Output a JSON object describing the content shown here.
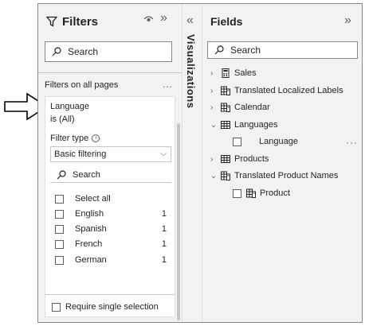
{
  "filters": {
    "title": "Filters",
    "search_label": "Search",
    "section_label": "Filters on all pages",
    "section_more": "...",
    "card": {
      "field": "Language",
      "condition": "is (All)",
      "filter_type_label": "Filter type",
      "filter_type_value": "Basic filtering",
      "search_label": "Search",
      "options": [
        {
          "label": "Select all",
          "count": ""
        },
        {
          "label": "English",
          "count": "1"
        },
        {
          "label": "Spanish",
          "count": "1"
        },
        {
          "label": "French",
          "count": "1"
        },
        {
          "label": "German",
          "count": "1"
        }
      ],
      "require_single": "Require single selection"
    }
  },
  "visualizations": {
    "label": "Visualizations"
  },
  "fields": {
    "title": "Fields",
    "search_label": "Search",
    "tree": [
      {
        "label": "Sales",
        "expanded": false,
        "icon": "table-calc-icon"
      },
      {
        "label": "Translated Localized Labels",
        "expanded": false,
        "icon": "table-calc-icon"
      },
      {
        "label": "Calendar",
        "expanded": false,
        "icon": "table-calc-icon"
      },
      {
        "label": "Languages",
        "expanded": true,
        "icon": "table-icon"
      },
      {
        "label": "Language",
        "child": true
      },
      {
        "label": "Products",
        "expanded": false,
        "icon": "table-icon"
      },
      {
        "label": "Translated Product Names",
        "expanded": true,
        "icon": "table-calc-icon"
      },
      {
        "label": "Product",
        "child": true,
        "icon": "calc-field-icon"
      }
    ],
    "more": "···"
  },
  "colors": {
    "pane_bg": "#f3f2f1",
    "border": "#8a8886",
    "text": "#252423"
  }
}
